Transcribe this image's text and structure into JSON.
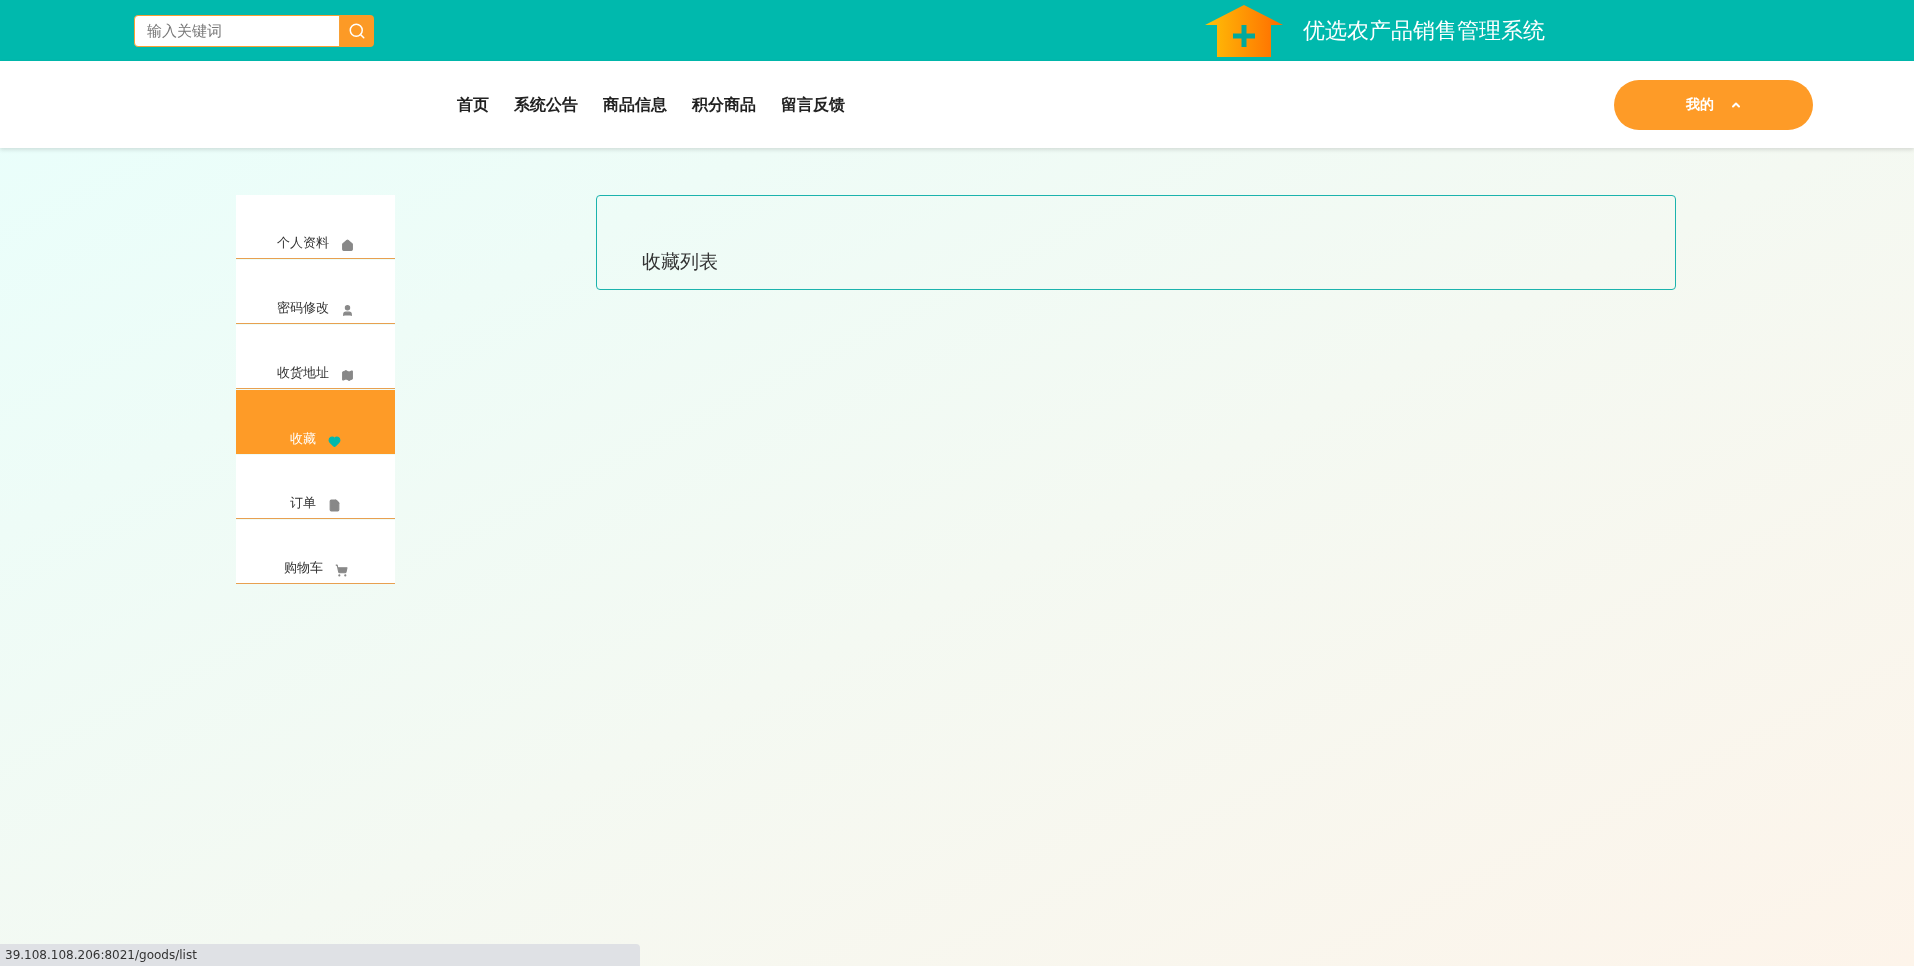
{
  "header": {
    "search": {
      "placeholder": "输入关键词"
    },
    "title": "优选农产品销售管理系统"
  },
  "nav": {
    "items": [
      {
        "label": "首页"
      },
      {
        "label": "系统公告"
      },
      {
        "label": "商品信息"
      },
      {
        "label": "积分商品"
      },
      {
        "label": "留言反馈"
      }
    ],
    "user_button": "我的"
  },
  "sidebar": {
    "items": [
      {
        "label": "个人资料",
        "selected": false
      },
      {
        "label": "密码修改",
        "selected": false
      },
      {
        "label": "收货地址",
        "selected": false
      },
      {
        "label": "收藏",
        "selected": true
      },
      {
        "label": "订单",
        "selected": false
      },
      {
        "label": "购物车",
        "selected": false
      }
    ]
  },
  "panel": {
    "title": "收藏列表"
  },
  "status_bar": "39.108.108.206:8021/goods/list"
}
